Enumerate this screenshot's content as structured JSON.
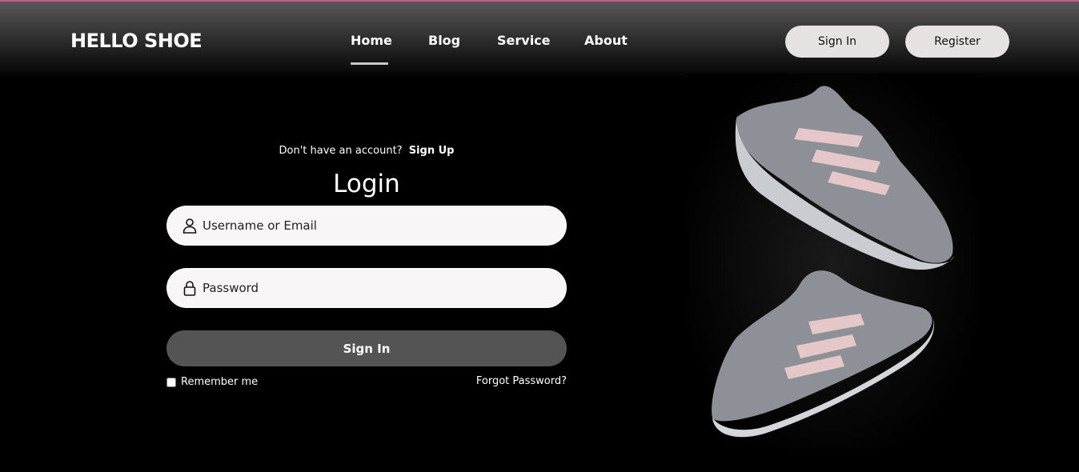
{
  "brand": {
    "logo": "HELLO SHOE"
  },
  "nav": {
    "links": [
      {
        "label": "Home",
        "active": true
      },
      {
        "label": "Blog"
      },
      {
        "label": "Service"
      },
      {
        "label": "About"
      }
    ],
    "signin_label": "Sign In",
    "register_label": "Register"
  },
  "login": {
    "signup_prompt": "Don't have an account?",
    "signup_link": "Sign Up",
    "title": "Login",
    "username_placeholder": "Username or Email",
    "password_placeholder": "Password",
    "submit_label": "Sign In",
    "remember_label": "Remember me",
    "forgot_label": "Forgot Password?"
  },
  "icons": {
    "username": "user-icon",
    "password": "lock-icon"
  },
  "colors": {
    "accent_line": "#c25d86",
    "button_light": "#e7e2e2",
    "button_dark": "#555455",
    "field_bg": "#f8f6f7"
  }
}
